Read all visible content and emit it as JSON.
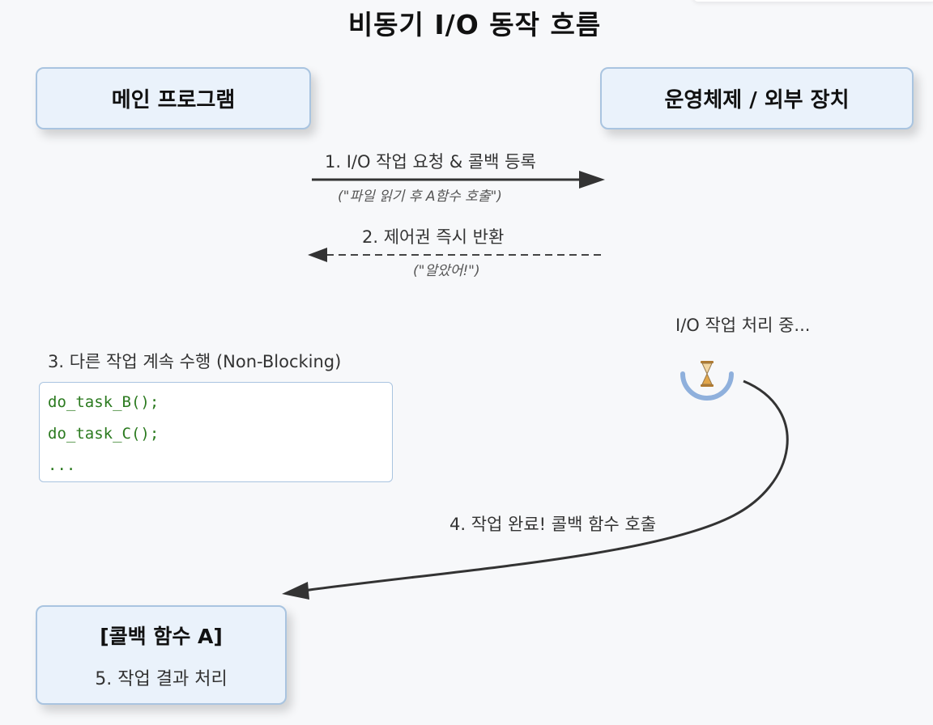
{
  "diagram": {
    "title": "비동기 I/O 동작 흐름",
    "participants": {
      "main_program": "메인 프로그램",
      "os_device": "운영체제 / 외부 장치"
    },
    "steps": {
      "step1": {
        "label": "1. I/O 작업 요청 & 콜백 등록",
        "note": "(\"파일 읽기 후 A함수 호출\")"
      },
      "step2": {
        "label": "2. 제어권 즉시 반환",
        "note": "(\"알았어!\")"
      },
      "step3": {
        "label": "3. 다른 작업 계속 수행 (Non-Blocking)",
        "code_lines": [
          "do_task_B();",
          "do_task_C();",
          "..."
        ]
      },
      "os_processing": {
        "label": "I/O 작업 처리 중..."
      },
      "step4": {
        "label": "4. 작업 완료! 콜백 함수 호출"
      },
      "callback": {
        "title": "[콜백 함수 A]",
        "label": "5. 작업 결과 처리"
      }
    },
    "colors": {
      "box_fill": "#eaf2fb",
      "box_border": "#a9c4e0",
      "arrow": "#333333",
      "code_text": "#2b7a1f",
      "hourglass_ring": "#8fb0dc",
      "hourglass_sand": "#e2a64a"
    },
    "icons": {
      "hourglass": "hourglass-icon"
    }
  }
}
